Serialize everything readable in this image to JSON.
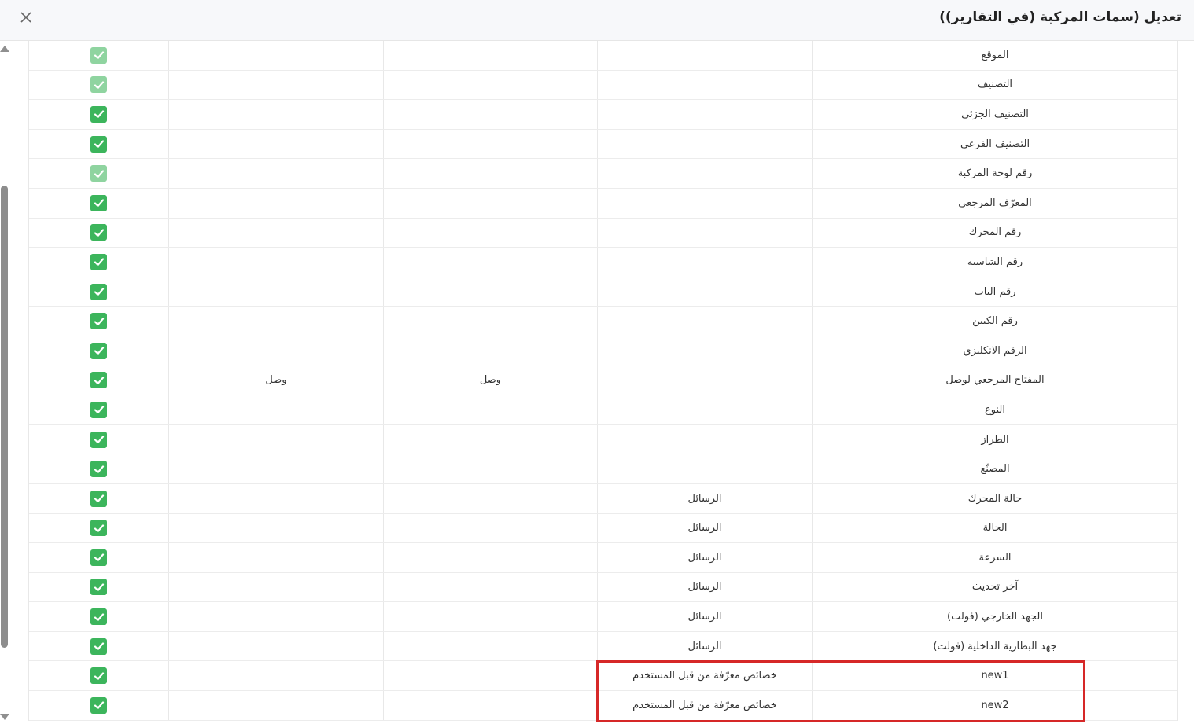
{
  "dialog": {
    "title": "تعديل (سمات المركبة (في التقارير))",
    "close_icon": "close-icon"
  },
  "rows": [
    {
      "name": "الموقع",
      "source": "",
      "col3": "",
      "col4": "",
      "checked": true,
      "disabled": true
    },
    {
      "name": "التصنيف",
      "source": "",
      "col3": "",
      "col4": "",
      "checked": true,
      "disabled": true
    },
    {
      "name": "التصنيف الجزئي",
      "source": "",
      "col3": "",
      "col4": "",
      "checked": true,
      "disabled": false
    },
    {
      "name": "التصنيف الفرعي",
      "source": "",
      "col3": "",
      "col4": "",
      "checked": true,
      "disabled": false
    },
    {
      "name": "رقم لوحة المركبة",
      "source": "",
      "col3": "",
      "col4": "",
      "checked": true,
      "disabled": true
    },
    {
      "name": "المعرّف المرجعي",
      "source": "",
      "col3": "",
      "col4": "",
      "checked": true,
      "disabled": false
    },
    {
      "name": "رقم المحرك",
      "source": "",
      "col3": "",
      "col4": "",
      "checked": true,
      "disabled": false
    },
    {
      "name": "رقم الشاسيه",
      "source": "",
      "col3": "",
      "col4": "",
      "checked": true,
      "disabled": false
    },
    {
      "name": "رقم الباب",
      "source": "",
      "col3": "",
      "col4": "",
      "checked": true,
      "disabled": false
    },
    {
      "name": "رقم الكبين",
      "source": "",
      "col3": "",
      "col4": "",
      "checked": true,
      "disabled": false
    },
    {
      "name": "الرقم الانكليزي",
      "source": "",
      "col3": "",
      "col4": "",
      "checked": true,
      "disabled": false
    },
    {
      "name": "المفتاح المرجعي لوصل",
      "source": "",
      "col3": "وصل",
      "col4": "وصل",
      "checked": true,
      "disabled": false
    },
    {
      "name": "النوع",
      "source": "",
      "col3": "",
      "col4": "",
      "checked": true,
      "disabled": false
    },
    {
      "name": "الطراز",
      "source": "",
      "col3": "",
      "col4": "",
      "checked": true,
      "disabled": false
    },
    {
      "name": "المصنّع",
      "source": "",
      "col3": "",
      "col4": "",
      "checked": true,
      "disabled": false
    },
    {
      "name": "حالة المحرك",
      "source": "الرسائل",
      "col3": "",
      "col4": "",
      "checked": true,
      "disabled": false
    },
    {
      "name": "الحالة",
      "source": "الرسائل",
      "col3": "",
      "col4": "",
      "checked": true,
      "disabled": false
    },
    {
      "name": "السرعة",
      "source": "الرسائل",
      "col3": "",
      "col4": "",
      "checked": true,
      "disabled": false
    },
    {
      "name": "آخر تحديث",
      "source": "الرسائل",
      "col3": "",
      "col4": "",
      "checked": true,
      "disabled": false
    },
    {
      "name": "الجهد الخارجي (فولت)",
      "source": "الرسائل",
      "col3": "",
      "col4": "",
      "checked": true,
      "disabled": false
    },
    {
      "name": "جهد البطارية الداخلية (فولت)",
      "source": "الرسائل",
      "col3": "",
      "col4": "",
      "checked": true,
      "disabled": false
    },
    {
      "name": "new1",
      "source": "خصائص معرّفة من قبل المستخدم",
      "col3": "",
      "col4": "",
      "checked": true,
      "disabled": false
    },
    {
      "name": "new2",
      "source": "خصائص معرّفة من قبل المستخدم",
      "col3": "",
      "col4": "",
      "checked": true,
      "disabled": false
    }
  ],
  "colors": {
    "checkbox": "#3cb55c",
    "checkbox_disabled": "#8fd4a0",
    "highlight": "#d62828"
  }
}
